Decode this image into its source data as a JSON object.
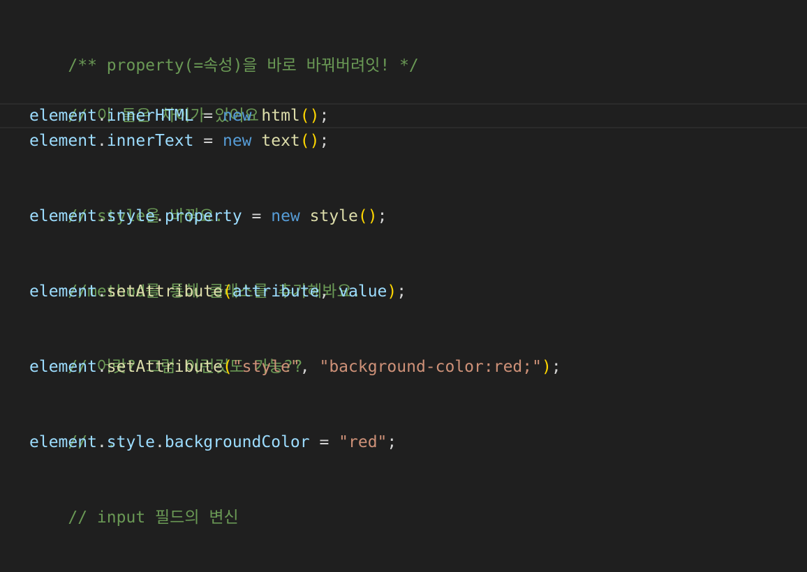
{
  "editor": {
    "lines": [
      {
        "comment": "/** property(=속성)을 바로 바꿔버려잇! */"
      },
      {
        "blank": ""
      },
      {
        "comment": "// 이 둘은 차이가 있어요!"
      },
      {
        "obj": "element",
        "dot": ".",
        "prop": "innerHTML",
        "eq": " = ",
        "kw": "new",
        "sp": " ",
        "fn": "html",
        "open": "(",
        "close": ")",
        "semi": ";"
      },
      {
        "obj": "element",
        "dot": ".",
        "prop": "innerText",
        "eq": " = ",
        "kw": "new",
        "sp": " ",
        "fn": "text",
        "open": "(",
        "close": ")",
        "semi": ";"
      },
      {
        "blank": ""
      },
      {
        "comment": "// style을 바꿔요."
      },
      {
        "obj": "element",
        "dot": ".",
        "prop": "style",
        "dot2": ".",
        "prop2": "property",
        "eq": " = ",
        "kw": "new",
        "sp": " ",
        "fn": "style",
        "open": "(",
        "close": ")",
        "semi": ";"
      },
      {
        "blank": ""
      },
      {
        "comment": "//method를 통해 클래스를 추가해봐요."
      },
      {
        "obj": "element",
        "dot": ".",
        "fn": "setAttribute",
        "open": "(",
        "arg1": "attribute",
        "comma": ", ",
        "arg2": "value",
        "close": ")",
        "semi": ";"
      },
      {
        "blank": ""
      },
      {
        "comment": "// 어랏? 그럼 이런것도 가능??"
      },
      {
        "obj": "element",
        "dot": ".",
        "fn": "setAttribute",
        "open": "(",
        "str1": "\"style\"",
        "comma": ", ",
        "str2": "\"background-color:red;\"",
        "close": ")",
        "semi": ";"
      },
      {
        "blank": ""
      },
      {
        "comment": "// ...."
      },
      {
        "obj": "element",
        "dot": ".",
        "prop": "style",
        "dot2": ".",
        "prop2": "backgroundColor",
        "eq": " = ",
        "str1": "\"red\"",
        "semi": ";"
      },
      {
        "blank": ""
      },
      {
        "comment": "// input 필드의 변신"
      }
    ]
  },
  "colors": {
    "background": "#1f1f1f",
    "comment": "#6a9955",
    "variable": "#9cdcfe",
    "function": "#dcdcaa",
    "keyword": "#569cd6",
    "bracket": "#ffd700",
    "string": "#ce9178"
  }
}
